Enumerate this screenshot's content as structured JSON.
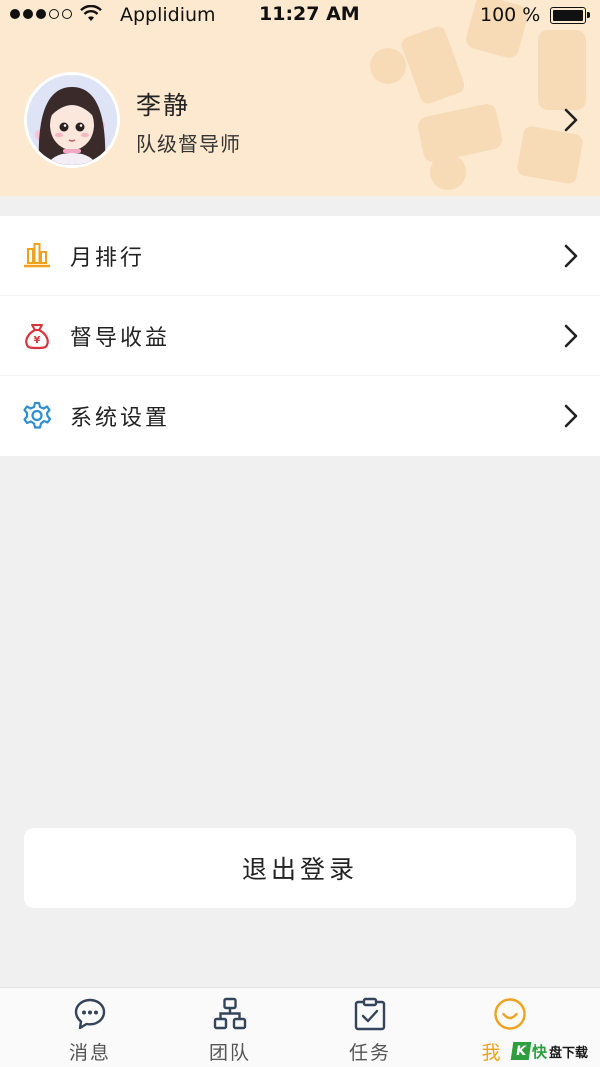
{
  "status_bar": {
    "carrier": "Applidium",
    "time": "11:27 AM",
    "battery": "100 %"
  },
  "profile": {
    "name": "李静",
    "role": "队级督导师"
  },
  "menu": {
    "items": [
      {
        "label": "月排行",
        "icon": "bar-chart-icon"
      },
      {
        "label": "督导收益",
        "icon": "money-bag-icon"
      },
      {
        "label": "系统设置",
        "icon": "gear-icon"
      }
    ]
  },
  "logout": {
    "label": "退出登录"
  },
  "tabbar": {
    "items": [
      {
        "label": "消息",
        "icon": "chat-bubble-icon",
        "active": false
      },
      {
        "label": "团队",
        "icon": "org-chart-icon",
        "active": false
      },
      {
        "label": "任务",
        "icon": "clipboard-check-icon",
        "active": false
      },
      {
        "label": "我",
        "icon": "smiley-icon",
        "active": true
      }
    ]
  },
  "watermark": {
    "mark": "K",
    "text": "快",
    "text2": "盘下载"
  },
  "colors": {
    "header_bg": "#fde9cf",
    "accent": "#f0a11e",
    "money_red": "#d9333b",
    "gear_blue": "#2f8fd0",
    "page_bg": "#f0f0f0"
  }
}
